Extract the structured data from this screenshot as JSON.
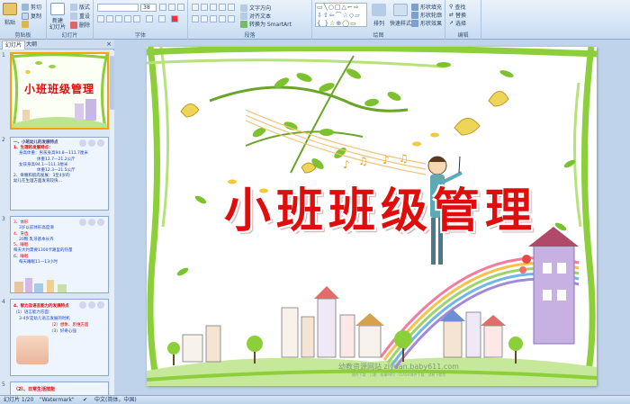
{
  "ribbon": {
    "clipboard": {
      "label": "剪贴板",
      "paste": "粘贴",
      "cut": "剪切",
      "copy": "复制",
      "format_painter": "格式刷"
    },
    "slides": {
      "label": "幻灯片",
      "new_slide": "新建\n幻灯片",
      "layout": "版式",
      "reset": "重设",
      "delete": "删除"
    },
    "font": {
      "label": "字体",
      "font_name": "",
      "font_size": "38"
    },
    "paragraph": {
      "label": "段落",
      "text_direction": "文字方向",
      "align_text": "对齐文本",
      "smartart": "转换为 SmartArt"
    },
    "drawing": {
      "label": "绘图",
      "arrange": "排列",
      "quick_styles": "快速样式",
      "shape_fill": "形状填充",
      "shape_outline": "形状轮廓",
      "shape_effects": "形状效果"
    },
    "editing": {
      "label": "编辑",
      "find": "查找",
      "replace": "替换",
      "select": "选择"
    }
  },
  "pane": {
    "tabs": [
      "幻灯片",
      "大纲"
    ],
    "close": "×",
    "thumbnails": [
      {
        "num": "1",
        "title": "小班班级管理"
      },
      {
        "num": "2",
        "lines": [
          "一、小班幼儿的发展特点",
          "1、生理的发展特点：",
          "身高体重：男孩身高94.8—111.7厘米",
          "体重12.7—21.2公斤",
          "女孩身高94.1—111.3厘米",
          "体重12.3—21.5公斤",
          "2、骨骼和肌肉发展：3至4岁的",
          "幼儿在生理方面发育较快…"
        ]
      },
      {
        "num": "3",
        "lines": [
          "3、体形",
          "3岁以前体形高度滑",
          "4、牙齿",
          "20颗 乳牙基本长齐",
          "5、睡眠",
          "每天大约需要1300卡路里的热量",
          "6、睡眠",
          "每天睡眠11—13小时"
        ]
      },
      {
        "num": "4",
        "lines": [
          "4、智力及语言能力的发展特点",
          "（1）语言能力方面：",
          "3-4岁是幼儿语言发展的时机",
          "（2）想象、思维方面",
          "（3）好奇心强"
        ]
      },
      {
        "num": "5",
        "lines": [
          "（2）、日常生活技能"
        ]
      }
    ]
  },
  "slide": {
    "title": "小班班级管理",
    "footer": "幼教资源网站  ziyuan.baby611.com",
    "sub": "课件下载 · 儿歌 · 故事MP3 · FLASH课件下载 · 试卷下载等"
  },
  "status": {
    "slide_info": "幻灯片 1/20",
    "theme": "\"Watermark\"",
    "language": "中文(简体，中国)"
  },
  "colors": {
    "title_red": "#e00d0d",
    "leaf_green": "#7cc22f",
    "selection": "#f6a400"
  }
}
